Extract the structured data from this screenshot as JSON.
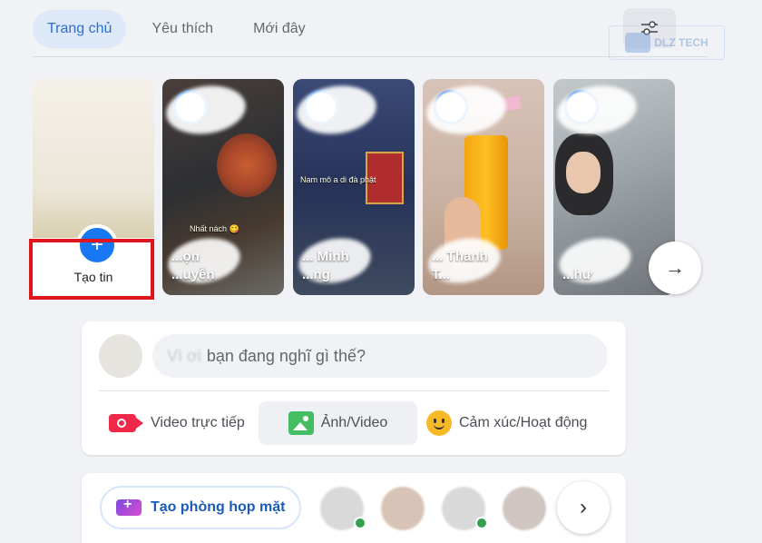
{
  "tabs": [
    {
      "label": "Trang chủ",
      "active": true
    },
    {
      "label": "Yêu thích",
      "active": false
    },
    {
      "label": "Mới đây",
      "active": false
    }
  ],
  "watermark": {
    "text": "DLZ TECH"
  },
  "stories": {
    "create_label": "Tạo tin",
    "items": [
      {
        "name_line1": "...ọn",
        "name_line2": "...uyễn",
        "overlay_text": "Nhất nách 😋"
      },
      {
        "name_line1": "... Minh",
        "name_line2": "...ng",
        "overlay_text": "Nam mô a di đà phật"
      },
      {
        "name_line1": "... Thanh",
        "name_line2": "T...",
        "overlay_text": ""
      },
      {
        "name_line1": "",
        "name_line2": "...hư",
        "overlay_text": ""
      }
    ],
    "next_icon": "→"
  },
  "composer": {
    "placeholder_blurred": "Vì ơi",
    "placeholder": "bạn đang nghĩ gì thế?",
    "actions": [
      {
        "label": "Video trực tiếp",
        "icon": "live-video-icon"
      },
      {
        "label": "Ảnh/Video",
        "icon": "photo-video-icon"
      },
      {
        "label": "Cảm xúc/Hoạt động",
        "icon": "feeling-activity-icon"
      }
    ]
  },
  "rooms": {
    "create_label": "Tạo phòng họp mặt",
    "next_icon": "›"
  },
  "colors": {
    "accent": "#1877f2",
    "highlight_border": "#e0141c",
    "tab_active_bg": "#dde8f8",
    "tab_active_text": "#2c6fd1"
  }
}
